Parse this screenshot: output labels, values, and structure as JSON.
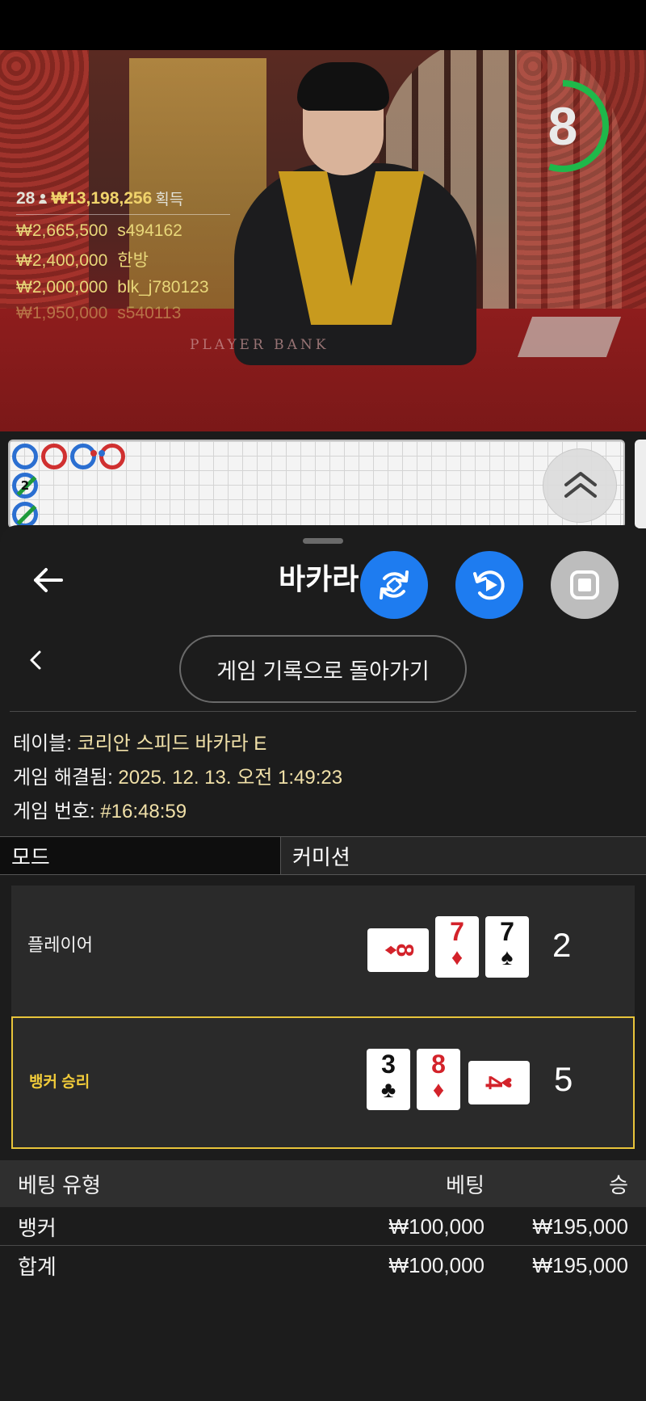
{
  "timer": {
    "seconds": "8",
    "remaining_fraction": 0.55
  },
  "winners": {
    "count": "28",
    "total": "₩13,198,256",
    "gain_label": "획득",
    "rows": [
      {
        "amount": "₩2,665,500",
        "name": "s494162"
      },
      {
        "amount": "₩2,400,000",
        "name": "한방"
      },
      {
        "amount": "₩2,000,000",
        "name": "blk_j780123"
      },
      {
        "amount": "₩1,950,000",
        "name": "s540113"
      }
    ]
  },
  "video": {
    "table_text": "PLAYER   BANK"
  },
  "roadmap": {
    "tie_count": "2"
  },
  "sheet": {
    "title": "바카라",
    "return_label": "게임 기록으로 돌아가기"
  },
  "info": {
    "table_label": "테이블: ",
    "table_value": "코리안 스피드 바카라 E",
    "resolved_label": "게임 해결됨: ",
    "resolved_value": "2025. 12. 13. 오전 1:49:23",
    "number_label": "게임 번호: ",
    "number_value": "#16:48:59"
  },
  "mode": {
    "mode_label": "모드",
    "mode_value": "커미션"
  },
  "player": {
    "label": "플레이어",
    "score": "2",
    "cards": [
      {
        "rank": "8",
        "suit": "♦",
        "color": "#d3222a",
        "orientation": "sideways"
      },
      {
        "rank": "7",
        "suit": "♦",
        "color": "#d3222a",
        "orientation": "upright"
      },
      {
        "rank": "7",
        "suit": "♠",
        "color": "#111111",
        "orientation": "upright"
      }
    ]
  },
  "banker": {
    "label": "뱅커 승리",
    "score": "5",
    "cards": [
      {
        "rank": "3",
        "suit": "♣",
        "color": "#111111",
        "orientation": "upright"
      },
      {
        "rank": "8",
        "suit": "♦",
        "color": "#d3222a",
        "orientation": "upright"
      },
      {
        "rank": "4",
        "suit": "♥",
        "color": "#d3222a",
        "orientation": "sideways"
      }
    ]
  },
  "bets": {
    "headers": {
      "type": "베팅 유형",
      "bet": "베팅",
      "win": "승"
    },
    "rows": [
      {
        "type": "뱅커",
        "bet": "₩100,000",
        "win": "₩195,000"
      },
      {
        "type": "합계",
        "bet": "₩100,000",
        "win": "₩195,000"
      }
    ]
  },
  "colors": {
    "accent_blue": "#1e7cf0",
    "winner_gold": "#e8c43a",
    "timer_green": "#1fb84a"
  },
  "icons": {
    "fab1": "rotate-camera-icon",
    "fab2": "replay-icon",
    "fab3": "stop-icon",
    "back": "arrow-left-icon",
    "collapse": "chevron-double-up-icon"
  }
}
